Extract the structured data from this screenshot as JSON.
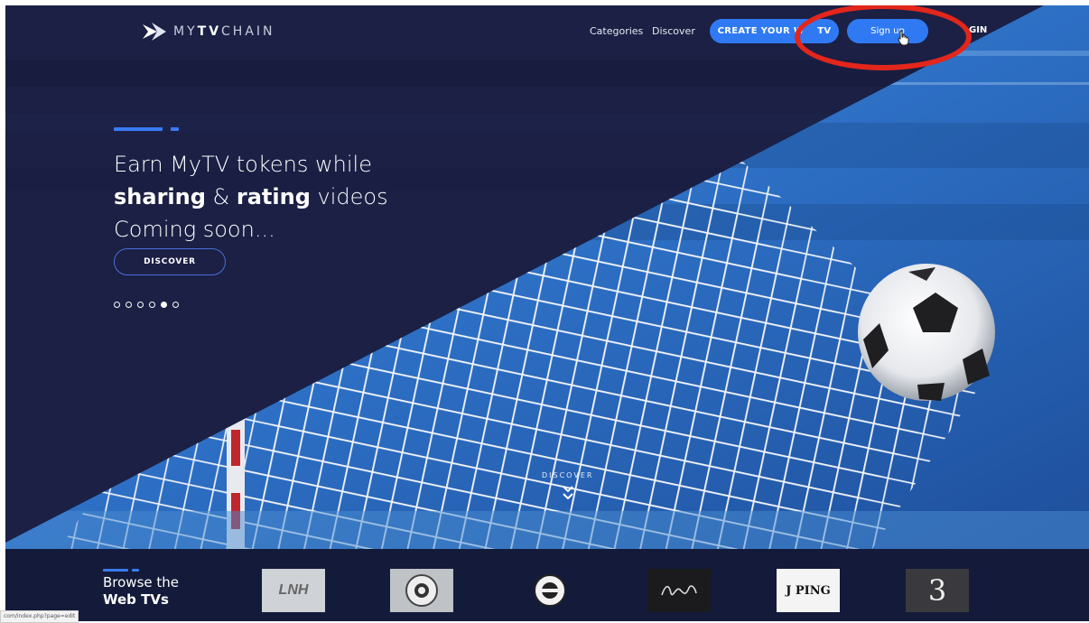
{
  "brand": {
    "name_prefix": "MY",
    "name_bold": "TV",
    "name_suffix": "CHAIN"
  },
  "nav": {
    "categories": "Categories",
    "discover": "Discover",
    "create_button": "CREATE YOUR W    TV",
    "signup_button": "Sign up",
    "login": "GIN"
  },
  "hero": {
    "line1": "Earn MyTV tokens while",
    "line2_bold_a": "sharing",
    "line2_mid": " & ",
    "line2_bold_b": "rating",
    "line2_end": " videos",
    "line3": "Coming soon...",
    "discover_button": "DISCOVER",
    "slides_total": 6,
    "slide_active_index": 4,
    "scroll_discover_label": "DISCOVER"
  },
  "browse": {
    "line1": "Browse the",
    "line2": "Web TVs"
  },
  "webtvs": [
    {
      "label": "LNH"
    },
    {
      "label": ""
    },
    {
      "label": ""
    },
    {
      "label": ""
    },
    {
      "label": "J PING"
    },
    {
      "label": "3"
    }
  ],
  "status_bar": "com/index.php?page=edit",
  "colors": {
    "accent": "#2f7af3",
    "header_bg": "#1a2040",
    "annotation": "#e3261b"
  }
}
